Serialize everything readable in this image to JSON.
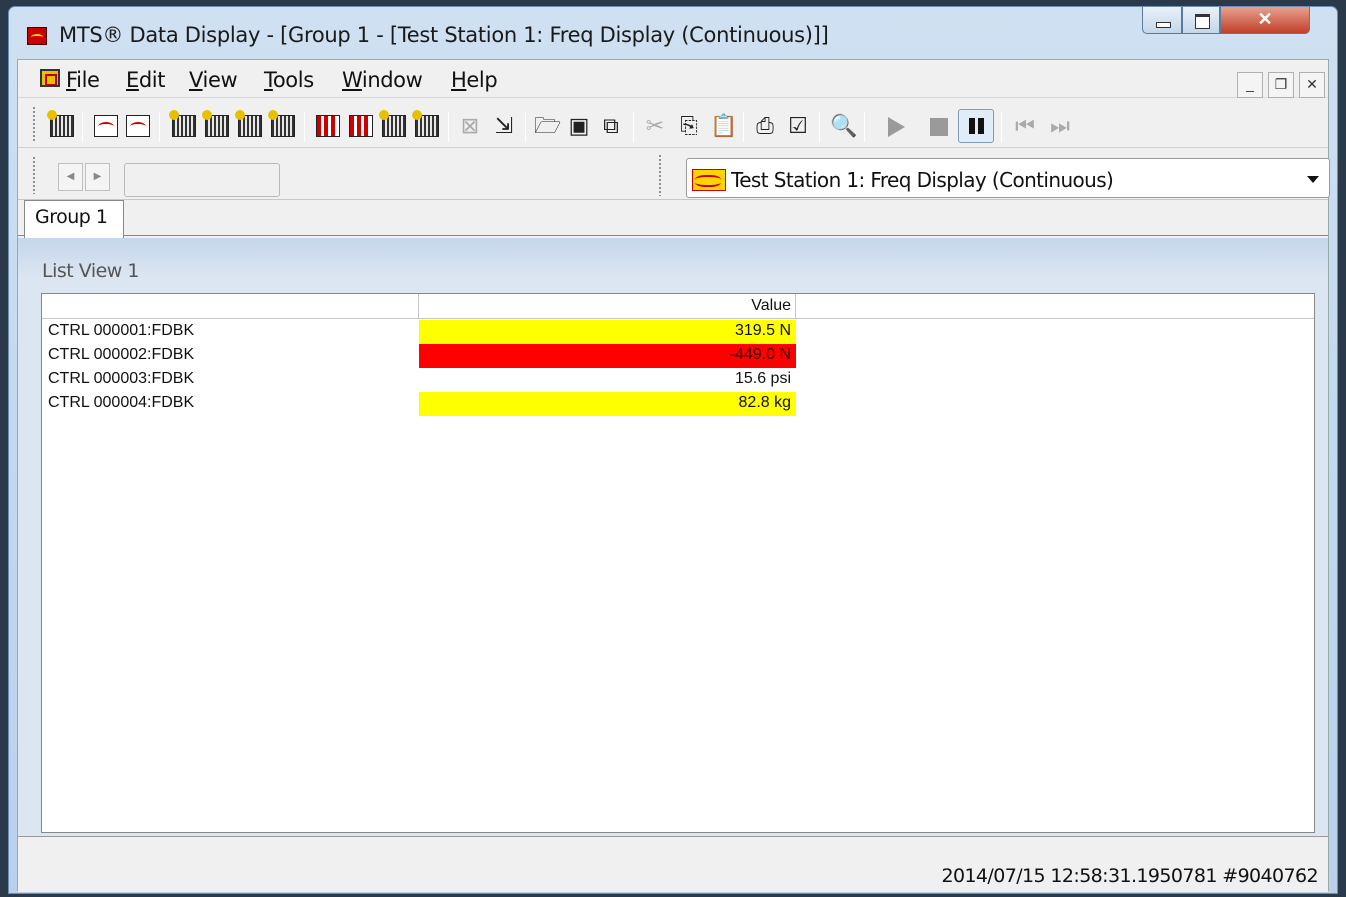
{
  "window": {
    "title": "MTS® Data Display - [Group 1 - [Test Station 1: Freq Display (Continuous)]]"
  },
  "menu": {
    "items": [
      {
        "first": "F",
        "rest": "ile"
      },
      {
        "first": "E",
        "rest": "dit"
      },
      {
        "first": "V",
        "rest": "iew"
      },
      {
        "first": "T",
        "rest": "ools"
      },
      {
        "first": "W",
        "rest": "indow"
      },
      {
        "first": "H",
        "rest": "elp"
      }
    ]
  },
  "toolbar": {
    "icons": [
      "new-meter-icon",
      "new-scope-icon",
      "new-plot-icon",
      "new-list-icon",
      "new-table-icon",
      "new-grid-icon",
      "new-array-icon",
      "new-bar-chart-icon",
      "new-histogram-icon",
      "new-list-view-icon",
      "new-color-display-icon",
      "delete-display-icon",
      "import-icon",
      "open-folder-icon",
      "save-icon",
      "save-all-icon",
      "cut-icon",
      "copy-icon",
      "paste-icon",
      "print-icon",
      "properties-icon",
      "zoom-icon",
      "play-icon",
      "stop-icon",
      "pause-icon",
      "rewind-icon",
      "fast-forward-icon"
    ]
  },
  "display_selector": {
    "value": "Test Station 1: Freq Display (Continuous)"
  },
  "tabs": [
    {
      "label": "Group 1"
    }
  ],
  "list_view": {
    "title": "List View 1",
    "columns": [
      "",
      "Value"
    ],
    "rows": [
      {
        "name": "CTRL 000001:FDBK",
        "value": "319.5 N",
        "color": "#ffff00",
        "text_color": "#111111"
      },
      {
        "name": "CTRL 000002:FDBK",
        "value": "-449.0 N",
        "color": "#ff0000",
        "text_color": "#3a0000"
      },
      {
        "name": "CTRL 000003:FDBK",
        "value": "15.6 psi",
        "color": "#ffffff",
        "text_color": "#111111"
      },
      {
        "name": "CTRL 000004:FDBK",
        "value": "82.8 kg",
        "color": "#ffff00",
        "text_color": "#111111"
      }
    ]
  },
  "status": {
    "text": "2014/07/15 12:58:31.1950781 #9040762"
  }
}
